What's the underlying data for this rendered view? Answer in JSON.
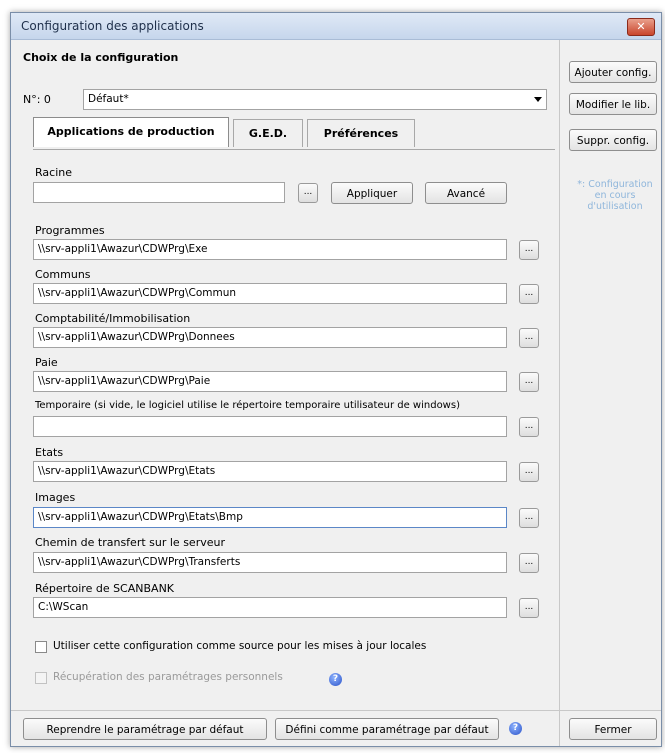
{
  "window": {
    "title": "Configuration des applications",
    "close_glyph": "✕"
  },
  "choix": {
    "heading": "Choix de la configuration",
    "num_label": "N°: 0",
    "selected": "Défaut*"
  },
  "side_buttons": {
    "ajouter": "Ajouter config.",
    "modifier": "Modifier le lib.",
    "supprimer": "Suppr. config."
  },
  "note": {
    "line1": "*: Configuration",
    "line2": "en cours",
    "line3": "d'utilisation"
  },
  "tabs": [
    {
      "label": "Applications de production",
      "active": true
    },
    {
      "label": "G.E.D.",
      "active": false
    },
    {
      "label": "Préférences",
      "active": false
    }
  ],
  "racine": {
    "label": "Racine",
    "value": "",
    "browse": "...",
    "appliquer": "Appliquer",
    "avance": "Avancé"
  },
  "fields": [
    {
      "label": "Programmes",
      "value": "\\\\srv-appli1\\Awazur\\CDWPrg\\Exe"
    },
    {
      "label": "Communs",
      "value": "\\\\srv-appli1\\Awazur\\CDWPrg\\Commun"
    },
    {
      "label": "Comptabilité/Immobilisation",
      "value": "\\\\srv-appli1\\Awazur\\CDWPrg\\Donnees"
    },
    {
      "label": "Paie",
      "value": "\\\\srv-appli1\\Awazur\\CDWPrg\\Paie"
    },
    {
      "label": "Temporaire (si vide, le logiciel utilise le répertoire temporaire utilisateur de windows)",
      "value": ""
    },
    {
      "label": "Etats",
      "value": "\\\\srv-appli1\\Awazur\\CDWPrg\\Etats"
    },
    {
      "label": "Images",
      "value": "\\\\srv-appli1\\Awazur\\CDWPrg\\Etats\\Bmp"
    },
    {
      "label": "Chemin de transfert sur le serveur",
      "value": "\\\\srv-appli1\\Awazur\\CDWPrg\\Transferts"
    },
    {
      "label": "Répertoire de SCANBANK",
      "value": "C:\\WScan"
    }
  ],
  "browse_glyph": "...",
  "checkbox_source": {
    "label": "Utiliser cette configuration comme source pour les mises à jour locales",
    "checked": false
  },
  "checkbox_recup": {
    "label": "Récupération des paramétrages personnels",
    "checked": false,
    "disabled": true
  },
  "help_glyph": "?",
  "bottom": {
    "reprendre": "Reprendre le paramétrage par défaut",
    "definir": "Défini comme paramétrage par défaut",
    "fermer": "Fermer"
  },
  "colors": {
    "note": "#8fb6db",
    "title_bg": "#c6d6ec",
    "close_bg": "#c9452c"
  }
}
